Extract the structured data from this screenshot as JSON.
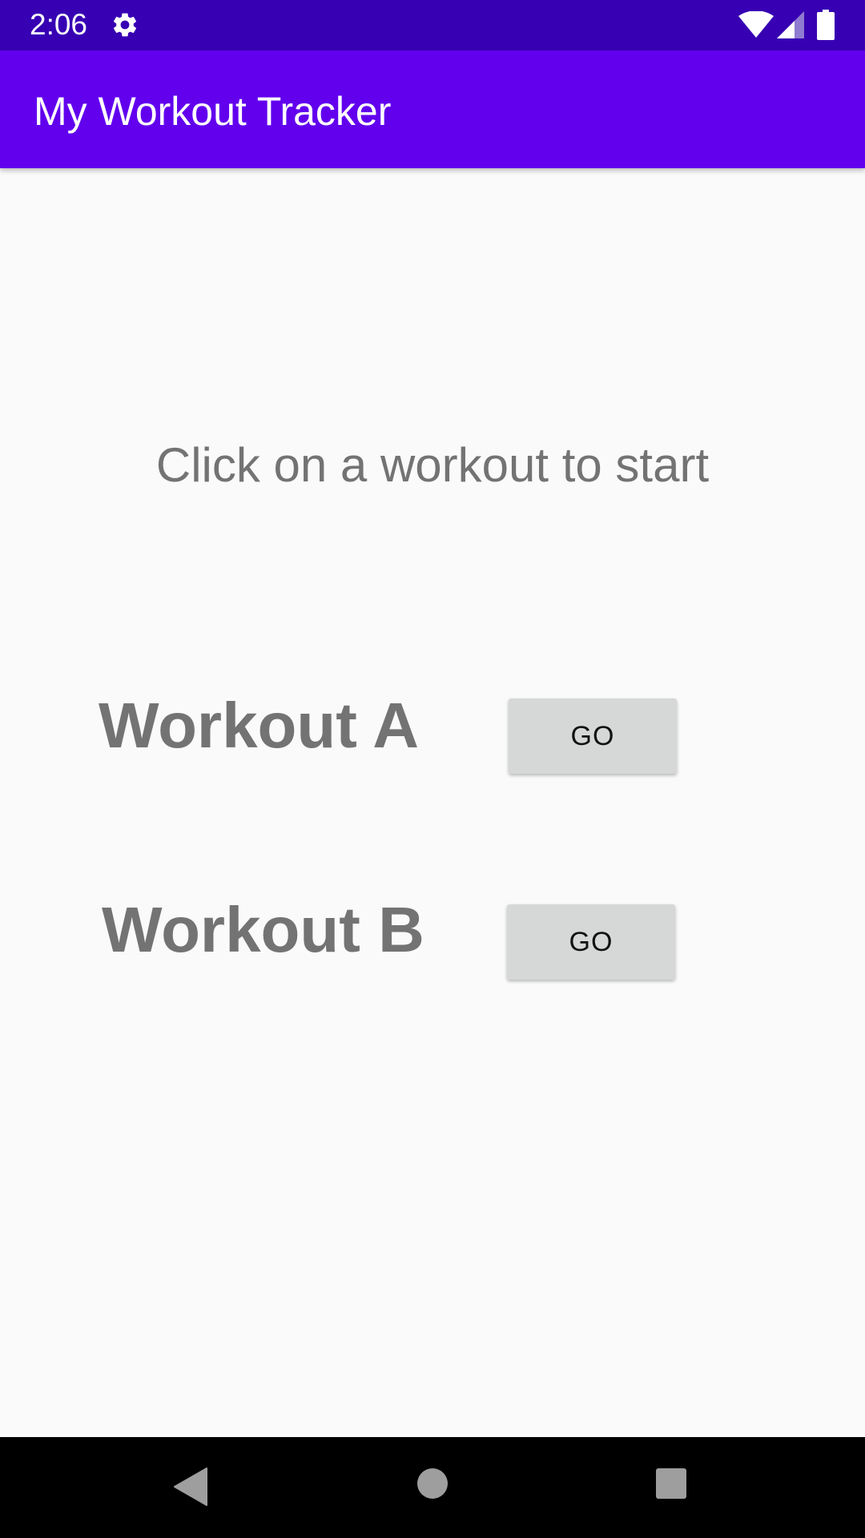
{
  "status_bar": {
    "time": "2:06",
    "icons": [
      "gear-icon",
      "wifi-icon",
      "signal-icon",
      "battery-icon"
    ],
    "background": "#3700b3"
  },
  "app_bar": {
    "title": "My Workout Tracker",
    "background": "#6200ee"
  },
  "main": {
    "instruction": "Click on a workout to start",
    "workouts": [
      {
        "label": "Workout A",
        "button_label": "GO"
      },
      {
        "label": "Workout B",
        "button_label": "GO"
      }
    ]
  },
  "nav_bar": {
    "icons": [
      "back-icon",
      "home-icon",
      "recent-apps-icon"
    ]
  }
}
